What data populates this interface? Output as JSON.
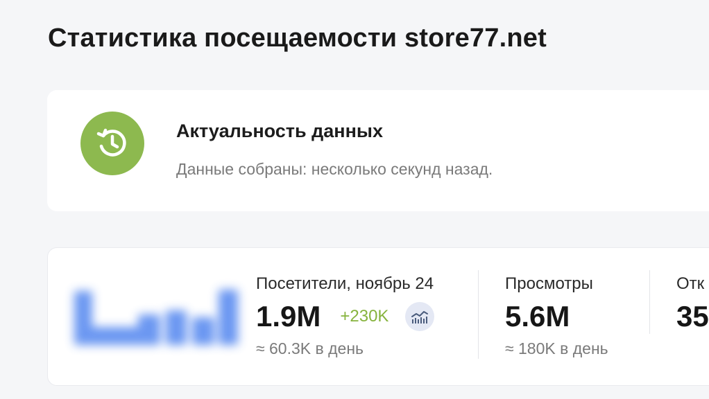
{
  "page": {
    "title": "Статистика посещаемости store77.net"
  },
  "freshness": {
    "title": "Актуальность данных",
    "subtitle": "Данные собраны: несколько секунд назад.",
    "icon": "history-clock-icon",
    "accent_color": "#8db94f"
  },
  "stats": {
    "chart_icon": "blurred-bar-chart",
    "chart_color": "#5b8cf0",
    "metrics": [
      {
        "label": "Посетители, ноябрь 24",
        "value": "1.9M",
        "delta": "+230K",
        "per_day": "≈ 60.3K в день",
        "trend_icon": "trend-chart-icon",
        "delta_color": "#86b33d"
      },
      {
        "label": "Просмотры",
        "value": "5.6M",
        "per_day": "≈ 180K в день"
      },
      {
        "label": "Отк",
        "value": "35"
      }
    ]
  }
}
